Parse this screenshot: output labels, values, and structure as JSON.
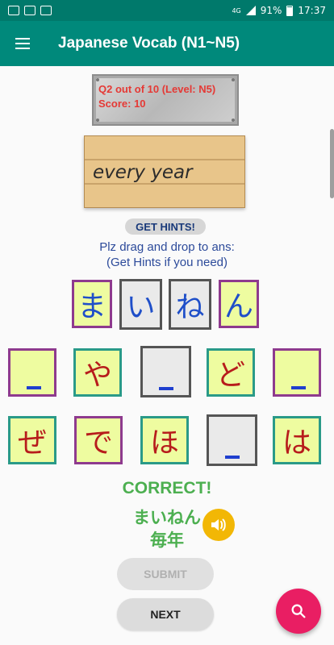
{
  "status_bar": {
    "network": "4G",
    "battery": "91%",
    "time": "17:37"
  },
  "app": {
    "title": "Japanese Vocab (N1~N5)"
  },
  "scoreboard": {
    "question": "Q2 out of 10 (Level: N5)",
    "score": "Score: 10"
  },
  "prompt_word": "every year",
  "hints_button": "GET HINTS!",
  "instructions": {
    "line1": "Plz drag and drop to ans:",
    "line2": "(Get Hints if you need)"
  },
  "answer_tiles": [
    "ま",
    "い",
    "ね",
    "ん"
  ],
  "option_row1": [
    "",
    "や",
    "",
    "ど",
    ""
  ],
  "option_row2": [
    "ぜ",
    "で",
    "ほ",
    "",
    "は"
  ],
  "result": {
    "status": "CORRECT!",
    "reading": "まいねん",
    "kanji": "毎年"
  },
  "buttons": {
    "submit": "SUBMIT",
    "next": "NEXT"
  },
  "colors": {
    "primary": "#00897b",
    "accent": "#e91e63",
    "correct": "#4caf50"
  },
  "icons": {
    "menu": "menu-icon",
    "speaker": "speaker-icon",
    "search": "search-icon"
  }
}
